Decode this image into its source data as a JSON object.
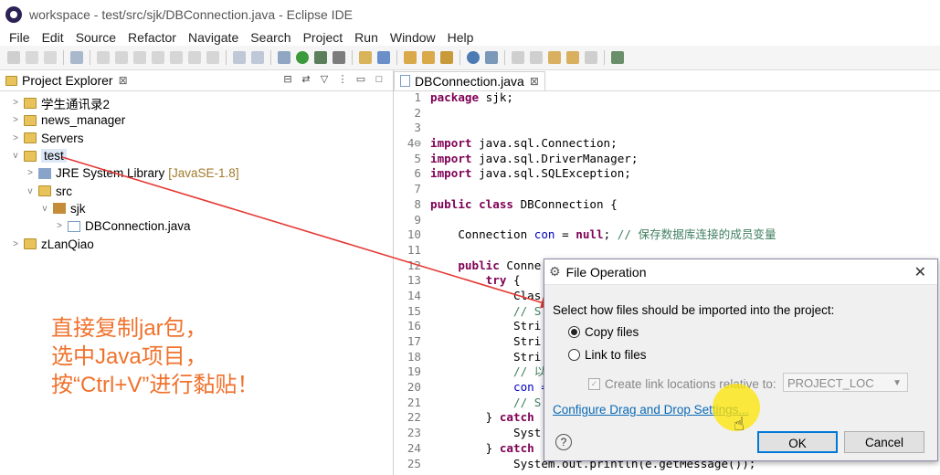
{
  "window": {
    "title": "workspace - test/src/sjk/DBConnection.java - Eclipse IDE"
  },
  "menu": [
    "File",
    "Edit",
    "Source",
    "Refactor",
    "Navigate",
    "Search",
    "Project",
    "Run",
    "Window",
    "Help"
  ],
  "explorer": {
    "tab_label": "Project Explorer",
    "tab_close": "⊠",
    "items": [
      {
        "label": "学生通讯录2",
        "indent": 0,
        "twisty": ">",
        "icon": "folder"
      },
      {
        "label": "news_manager",
        "indent": 0,
        "twisty": ">",
        "icon": "folder"
      },
      {
        "label": "Servers",
        "indent": 0,
        "twisty": ">",
        "icon": "folder"
      },
      {
        "label": "test",
        "indent": 0,
        "twisty": "v",
        "icon": "folder",
        "selected": true
      },
      {
        "label": "JRE System Library",
        "suffix": "[JavaSE-1.8]",
        "indent": 1,
        "twisty": ">",
        "icon": "jar"
      },
      {
        "label": "src",
        "indent": 1,
        "twisty": "v",
        "icon": "folder"
      },
      {
        "label": "sjk",
        "indent": 2,
        "twisty": "v",
        "icon": "pkg"
      },
      {
        "label": "DBConnection.java",
        "indent": 3,
        "twisty": ">",
        "icon": "jfile"
      },
      {
        "label": "zLanQiao",
        "indent": 0,
        "twisty": ">",
        "icon": "folder"
      }
    ]
  },
  "annotation": {
    "line1": "直接复制jar包，",
    "line2": "选中Java项目，",
    "line3": "按“Ctrl+V”进行黏贴！"
  },
  "editor": {
    "tab_label": "DBConnection.java",
    "tab_close": "⊠",
    "lines": [
      {
        "n": "1",
        "t": "package sjk;"
      },
      {
        "n": "2",
        "t": ""
      },
      {
        "n": "3",
        "t": ""
      },
      {
        "n": "4⊖",
        "t": "import java.sql.Connection;"
      },
      {
        "n": "5",
        "t": "import java.sql.DriverManager;"
      },
      {
        "n": "6",
        "t": "import java.sql.SQLException;"
      },
      {
        "n": "7",
        "t": ""
      },
      {
        "n": "8",
        "t": "public class DBConnection {"
      },
      {
        "n": "9",
        "t": ""
      },
      {
        "n": "10",
        "t": "    Connection con = null; // 保存数据库连接的成员变量"
      },
      {
        "n": "11",
        "t": ""
      },
      {
        "n": "12",
        "t": "    public Conne"
      },
      {
        "n": "13",
        "t": "        try {"
      },
      {
        "n": "14",
        "t": "            Clas"
      },
      {
        "n": "15",
        "t": "            // S"
      },
      {
        "n": "16",
        "t": "            Stri"
      },
      {
        "n": "17",
        "t": "            Stri"
      },
      {
        "n": "18",
        "t": "            Stri"
      },
      {
        "n": "19",
        "t": "            // 以"
      },
      {
        "n": "20",
        "t": "            con ="
      },
      {
        "n": "21",
        "t": "            // S"
      },
      {
        "n": "22",
        "t": "        } catch"
      },
      {
        "n": "23",
        "t": "            Syst"
      },
      {
        "n": "24",
        "t": "        } catch"
      },
      {
        "n": "25",
        "t": "            System.out.println(e.getMessage());"
      }
    ]
  },
  "dialog": {
    "title": "File Operation",
    "question": "Select how files should be imported into the project:",
    "option_copy": "Copy files",
    "option_link": "Link to files",
    "checkbox_label": "Create link locations relative to:",
    "select_value": "PROJECT_LOC",
    "link": "Configure Drag and Drop Settings...",
    "ok": "OK",
    "cancel": "Cancel",
    "close": "✕",
    "help": "?"
  },
  "colors": {
    "annotation": "#f0722d",
    "arrow": "#e53935",
    "keyword": "#7f0055",
    "comment": "#3f7f5f",
    "link": "#0a6ab6"
  }
}
